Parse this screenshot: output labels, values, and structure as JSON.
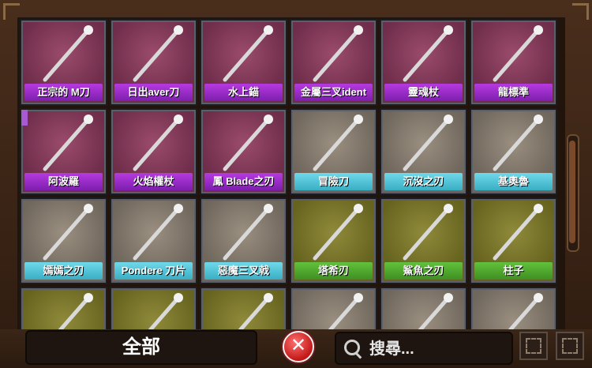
{
  "items": [
    {
      "label": "正宗的 M刀",
      "bg": "purple",
      "lb": "purple",
      "tab": false
    },
    {
      "label": "日出aver刀",
      "bg": "purple",
      "lb": "purple",
      "tab": false
    },
    {
      "label": "水上錨",
      "bg": "purple",
      "lb": "purple",
      "tab": false
    },
    {
      "label": "金屬三叉ident",
      "bg": "purple",
      "lb": "purple",
      "tab": false
    },
    {
      "label": "靈魂杖",
      "bg": "purple",
      "lb": "purple",
      "tab": false
    },
    {
      "label": "龍標準",
      "bg": "purple",
      "lb": "purple",
      "tab": false
    },
    {
      "label": "阿波羅",
      "bg": "purple",
      "lb": "purple",
      "tab": true
    },
    {
      "label": "火焰權杖",
      "bg": "purple",
      "lb": "purple",
      "tab": false
    },
    {
      "label": "鳳 Blade之刃",
      "bg": "purple",
      "lb": "purple",
      "tab": false
    },
    {
      "label": "冒險刀",
      "bg": "grey",
      "lb": "cyan",
      "tab": false
    },
    {
      "label": "沉沒之刃",
      "bg": "grey",
      "lb": "cyan",
      "tab": false
    },
    {
      "label": "基奧魯",
      "bg": "grey",
      "lb": "cyan",
      "tab": false
    },
    {
      "label": "嫣嫣之刃",
      "bg": "grey",
      "lb": "cyan",
      "tab": false
    },
    {
      "label": "Pondere 刀片",
      "bg": "grey",
      "lb": "cyan",
      "tab": false
    },
    {
      "label": "惡魔三叉戟",
      "bg": "grey",
      "lb": "cyan",
      "tab": false
    },
    {
      "label": "塔希刃",
      "bg": "olive",
      "lb": "green",
      "tab": false
    },
    {
      "label": "鯊魚之刃",
      "bg": "olive",
      "lb": "green",
      "tab": false
    },
    {
      "label": "柱子",
      "bg": "olive",
      "lb": "green",
      "tab": false
    },
    {
      "label": "",
      "bg": "olive",
      "lb": "green",
      "tab": false
    },
    {
      "label": "",
      "bg": "olive",
      "lb": "green",
      "tab": false
    },
    {
      "label": "",
      "bg": "olive",
      "lb": "green",
      "tab": false
    },
    {
      "label": "",
      "bg": "grey",
      "lb": "cyan",
      "tab": false
    },
    {
      "label": "",
      "bg": "grey",
      "lb": "cyan",
      "tab": false
    },
    {
      "label": "",
      "bg": "grey",
      "lb": "cyan",
      "tab": false
    }
  ],
  "filter": {
    "label": "全部"
  },
  "search": {
    "placeholder": "搜尋..."
  }
}
